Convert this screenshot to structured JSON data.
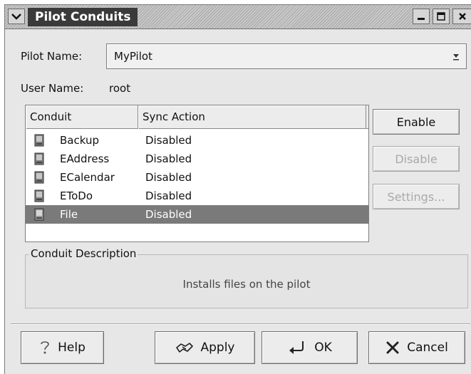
{
  "window": {
    "title": "Pilot Conduits",
    "menu_icon": "chevron-down-icon",
    "minimize_icon": "minimize-icon",
    "maximize_icon": "maximize-icon",
    "close_icon": "close-icon"
  },
  "form": {
    "pilot_name_label": "Pilot Name:",
    "pilot_name_value": "MyPilot",
    "user_name_label": "User Name:",
    "user_name_value": "root"
  },
  "conduit_list": {
    "columns": [
      "Conduit",
      "Sync Action"
    ],
    "rows": [
      {
        "conduit": "Backup",
        "sync_action": "Disabled",
        "selected": false
      },
      {
        "conduit": "EAddress",
        "sync_action": "Disabled",
        "selected": false
      },
      {
        "conduit": "ECalendar",
        "sync_action": "Disabled",
        "selected": false
      },
      {
        "conduit": "EToDo",
        "sync_action": "Disabled",
        "selected": false
      },
      {
        "conduit": "File",
        "sync_action": "Disabled",
        "selected": true
      }
    ],
    "row_icon": "pilot-device-icon"
  },
  "side_buttons": {
    "enable": "Enable",
    "disable": "Disable",
    "settings": "Settings..."
  },
  "description": {
    "title": "Conduit Description",
    "text": "Installs files on the pilot"
  },
  "bottom_buttons": {
    "help": "Help",
    "apply": "Apply",
    "ok": "OK",
    "cancel": "Cancel"
  },
  "colors": {
    "title_text_bg": "#3a3a3a",
    "selection": "#7a7a7a",
    "window_bg": "#e7e7e7"
  }
}
